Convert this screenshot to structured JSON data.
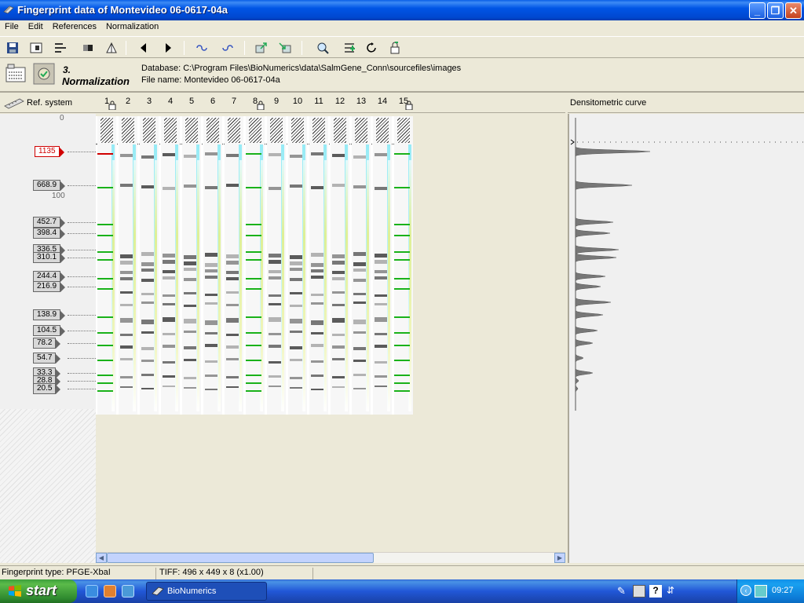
{
  "window": {
    "title": "Fingerprint data of Montevideo 06-0617-04a",
    "buttons": {
      "minimize": "_",
      "restore": "❐",
      "close": "✕"
    }
  },
  "menu": [
    "File",
    "Edit",
    "References",
    "Normalization"
  ],
  "toolbar": {
    "icons": [
      "save-icon",
      "layout-icon",
      "align-icon",
      "contrast-icon",
      "mirror-icon",
      "previous-icon",
      "next-icon",
      "undo-link-icon",
      "redo-link-icon",
      "export-icon",
      "import-icon",
      "zoom-icon",
      "add-lanes-icon",
      "refresh-icon",
      "lock-icon"
    ]
  },
  "info": {
    "step_number": "3.",
    "step_name": "Normalization",
    "database": "Database: C:\\Program Files\\BioNumerics\\data\\SalmGene_Conn\\sourcefiles\\images",
    "file_name": "File name: Montevideo 06-0617-04a"
  },
  "ref_system": {
    "header": "Ref. system",
    "axis_labels": [
      "0",
      "100"
    ],
    "markers": [
      {
        "label": "1135",
        "highlighted": true
      },
      {
        "label": "668.9"
      },
      {
        "label": "452.7"
      },
      {
        "label": "398.4"
      },
      {
        "label": "336.5"
      },
      {
        "label": "310.1"
      },
      {
        "label": "244.4"
      },
      {
        "label": "216.9"
      },
      {
        "label": "138.9"
      },
      {
        "label": "104.5"
      },
      {
        "label": "78.2"
      },
      {
        "label": "54.7"
      },
      {
        "label": "33.3"
      },
      {
        "label": "28.8"
      },
      {
        "label": "20.5"
      }
    ]
  },
  "lanes": [
    "1",
    "2",
    "3",
    "4",
    "5",
    "6",
    "7",
    "8",
    "9",
    "10",
    "11",
    "12",
    "13",
    "14",
    "15"
  ],
  "reference_lanes": [
    "1",
    "8",
    "15"
  ],
  "densitometric": {
    "header": "Densitometric curve"
  },
  "status": {
    "fingerprint_type": "Fingerprint type: PFGE-XbaI",
    "tiff_info": "TIFF: 496 x 449 x 8 (x1.00)"
  },
  "taskbar": {
    "start": "start",
    "task_label": "BioNumerics",
    "clock": "09:27"
  }
}
